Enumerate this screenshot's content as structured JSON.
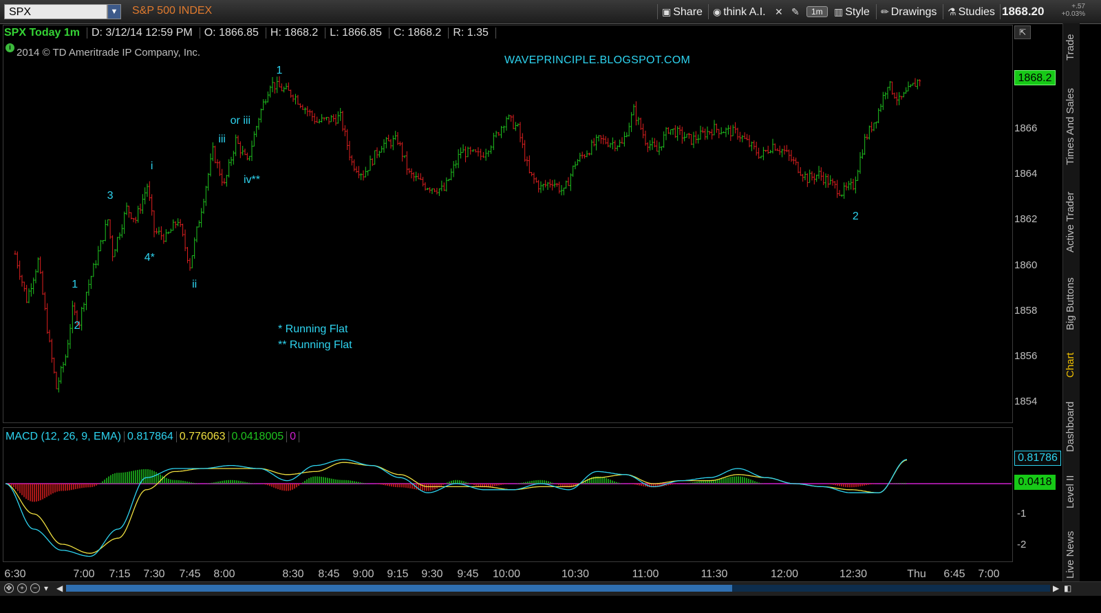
{
  "toolbar": {
    "symbol": "SPX",
    "symbol_name": "S&P 500 INDEX",
    "share": "Share",
    "think_ai": "think A.I.",
    "timeframe": "1m",
    "style": "Style",
    "drawings": "Drawings",
    "studies": "Studies",
    "last_price": "1868.20",
    "change": "+.57",
    "change_pct": "+0.03%"
  },
  "side_tabs": [
    "Trade",
    "Times And Sales",
    "Active Trader",
    "Big Buttons",
    "Chart",
    "Dashboard",
    "Level II",
    "Live News"
  ],
  "side_tab_active": "Chart",
  "info": {
    "symbol_tf": "SPX Today 1m",
    "date": "D: 3/12/14 12:59 PM",
    "open": "O: 1866.85",
    "high": "H: 1868.2",
    "low": "L: 1866.85",
    "close": "C: 1868.2",
    "range": "R: 1.35"
  },
  "copyright": "2014 © TD Ameritrade IP Company, Inc.",
  "blog": "WAVEPRINCIPLE.BLOGSPOT.COM",
  "notes": [
    "* Running Flat",
    "** Running Flat"
  ],
  "last_price_label": "1868.2",
  "macd": {
    "legend": "MACD (12, 26, 9, EMA)",
    "value": "0.817864",
    "avg": "0.776063",
    "diff": "0.0418005",
    "other": "0",
    "value_box": "0.81786",
    "diff_box": "0.0418",
    "ticks": [
      "-1",
      "-2"
    ]
  },
  "colors": {
    "up": "#1fc41f",
    "down": "#e02020",
    "macd_value": "#2ed4f0",
    "macd_avg": "#f0e040",
    "hist_pos": "#1fc41f",
    "hist_neg": "#e02020",
    "zero_line": "#d020d0",
    "annotation": "#2ed4f0"
  },
  "chart_data": {
    "type": "candlestick",
    "title": "SPX Today 1m",
    "y_ticks": [
      1854,
      1856,
      1858,
      1860,
      1862,
      1864,
      1866
    ],
    "ylim": [
      1853,
      1869
    ],
    "x_ticks": [
      "6:30",
      "7:00",
      "7:15",
      "7:30",
      "7:45",
      "8:00",
      "8:30",
      "8:45",
      "9:00",
      "9:15",
      "9:30",
      "9:45",
      "10:00",
      "10:30",
      "11:00",
      "11:30",
      "12:00",
      "12:30",
      "Thu",
      "6:45",
      "7:00"
    ],
    "close_path": [
      {
        "t": "6:30",
        "v": 1860.5
      },
      {
        "t": "6:35",
        "v": 1858.5
      },
      {
        "t": "6:40",
        "v": 1860.2
      },
      {
        "t": "6:45",
        "v": 1856.5
      },
      {
        "t": "6:48",
        "v": 1854.6
      },
      {
        "t": "6:52",
        "v": 1856.0
      },
      {
        "t": "6:55",
        "v": 1858.0
      },
      {
        "t": "6:58",
        "v": 1857.5
      },
      {
        "t": "7:00",
        "v": 1858.5
      },
      {
        "t": "7:05",
        "v": 1860.2
      },
      {
        "t": "7:10",
        "v": 1862.0
      },
      {
        "t": "7:12",
        "v": 1860.5
      },
      {
        "t": "7:18",
        "v": 1862.5
      },
      {
        "t": "7:22",
        "v": 1862.0
      },
      {
        "t": "7:27",
        "v": 1863.5
      },
      {
        "t": "7:30",
        "v": 1861.5
      },
      {
        "t": "7:35",
        "v": 1861.2
      },
      {
        "t": "7:40",
        "v": 1862.0
      },
      {
        "t": "7:45",
        "v": 1860.0
      },
      {
        "t": "7:50",
        "v": 1862.5
      },
      {
        "t": "7:55",
        "v": 1865.0
      },
      {
        "t": "8:00",
        "v": 1863.5
      },
      {
        "t": "8:05",
        "v": 1865.5
      },
      {
        "t": "8:10",
        "v": 1864.5
      },
      {
        "t": "8:15",
        "v": 1866.5
      },
      {
        "t": "8:20",
        "v": 1868.0
      },
      {
        "t": "8:30",
        "v": 1867.5
      },
      {
        "t": "8:40",
        "v": 1866.3
      },
      {
        "t": "8:50",
        "v": 1866.5
      },
      {
        "t": "8:55",
        "v": 1864.5
      },
      {
        "t": "9:00",
        "v": 1864.0
      },
      {
        "t": "9:08",
        "v": 1865.3
      },
      {
        "t": "9:15",
        "v": 1865.5
      },
      {
        "t": "9:20",
        "v": 1864.0
      },
      {
        "t": "9:27",
        "v": 1863.5
      },
      {
        "t": "9:35",
        "v": 1863.3
      },
      {
        "t": "9:42",
        "v": 1865.0
      },
      {
        "t": "9:50",
        "v": 1864.8
      },
      {
        "t": "9:55",
        "v": 1865.5
      },
      {
        "t": "10:00",
        "v": 1866.5
      },
      {
        "t": "10:05",
        "v": 1866.0
      },
      {
        "t": "10:10",
        "v": 1864.0
      },
      {
        "t": "10:15",
        "v": 1863.4
      },
      {
        "t": "10:20",
        "v": 1863.7
      },
      {
        "t": "10:25",
        "v": 1863.2
      },
      {
        "t": "10:30",
        "v": 1864.5
      },
      {
        "t": "10:40",
        "v": 1865.5
      },
      {
        "t": "10:50",
        "v": 1865.3
      },
      {
        "t": "10:55",
        "v": 1866.8
      },
      {
        "t": "11:00",
        "v": 1865.5
      },
      {
        "t": "11:05",
        "v": 1865.0
      },
      {
        "t": "11:10",
        "v": 1866.0
      },
      {
        "t": "11:20",
        "v": 1865.5
      },
      {
        "t": "11:30",
        "v": 1866.0
      },
      {
        "t": "11:40",
        "v": 1865.8
      },
      {
        "t": "11:50",
        "v": 1864.8
      },
      {
        "t": "11:55",
        "v": 1865.3
      },
      {
        "t": "12:00",
        "v": 1865.0
      },
      {
        "t": "12:10",
        "v": 1863.8
      },
      {
        "t": "12:15",
        "v": 1864.0
      },
      {
        "t": "12:25",
        "v": 1863.2
      },
      {
        "t": "12:30",
        "v": 1863.5
      },
      {
        "t": "12:35",
        "v": 1865.5
      },
      {
        "t": "12:40",
        "v": 1866.5
      },
      {
        "t": "12:45",
        "v": 1868.0
      },
      {
        "t": "12:50",
        "v": 1867.2
      },
      {
        "t": "12:59",
        "v": 1868.2
      }
    ],
    "wave_labels": [
      {
        "text": "1",
        "t": "6:56",
        "v": 1859.1
      },
      {
        "text": "2",
        "t": "6:57",
        "v": 1857.3
      },
      {
        "text": "3",
        "t": "7:11",
        "v": 1863.0
      },
      {
        "text": "i",
        "t": "7:29",
        "v": 1864.3
      },
      {
        "text": "4*",
        "t": "7:28",
        "v": 1860.3
      },
      {
        "text": "ii",
        "t": "7:47",
        "v": 1859.1
      },
      {
        "text": "iii",
        "t": "7:59",
        "v": 1865.5
      },
      {
        "text": "or iii",
        "t": "8:07",
        "v": 1866.3
      },
      {
        "text": "iv**",
        "t": "8:12",
        "v": 1863.7
      },
      {
        "text": "1",
        "t": "8:24",
        "v": 1868.5
      },
      {
        "text": "2",
        "t": "12:31",
        "v": 1862.1
      }
    ],
    "macd_series": [
      {
        "name": "MACD (12, 26, 9, EMA)",
        "values": [
          0.0,
          -1.5,
          -2.2,
          -2.4,
          -1.5,
          0.2,
          0.5,
          0.5,
          0.6,
          0.5,
          0.1,
          0.6,
          0.8,
          0.6,
          0.2,
          -0.3,
          0.0,
          -0.2,
          -0.2,
          0.0,
          -0.2,
          0.4,
          0.3,
          -0.1,
          0.1,
          0.2,
          0.5,
          0.2,
          0.0,
          -0.1,
          -0.3,
          -0.3,
          0.8
        ]
      },
      {
        "name": "0.776063",
        "values": [
          0.0,
          -1.0,
          -2.0,
          -2.3,
          -1.8,
          -0.2,
          0.4,
          0.5,
          0.5,
          0.5,
          0.3,
          0.4,
          0.7,
          0.6,
          0.3,
          -0.1,
          -0.1,
          -0.1,
          -0.2,
          -0.1,
          -0.1,
          0.2,
          0.3,
          0.0,
          0.1,
          0.1,
          0.3,
          0.2,
          0.0,
          -0.1,
          -0.2,
          -0.3,
          0.78
        ]
      }
    ]
  }
}
